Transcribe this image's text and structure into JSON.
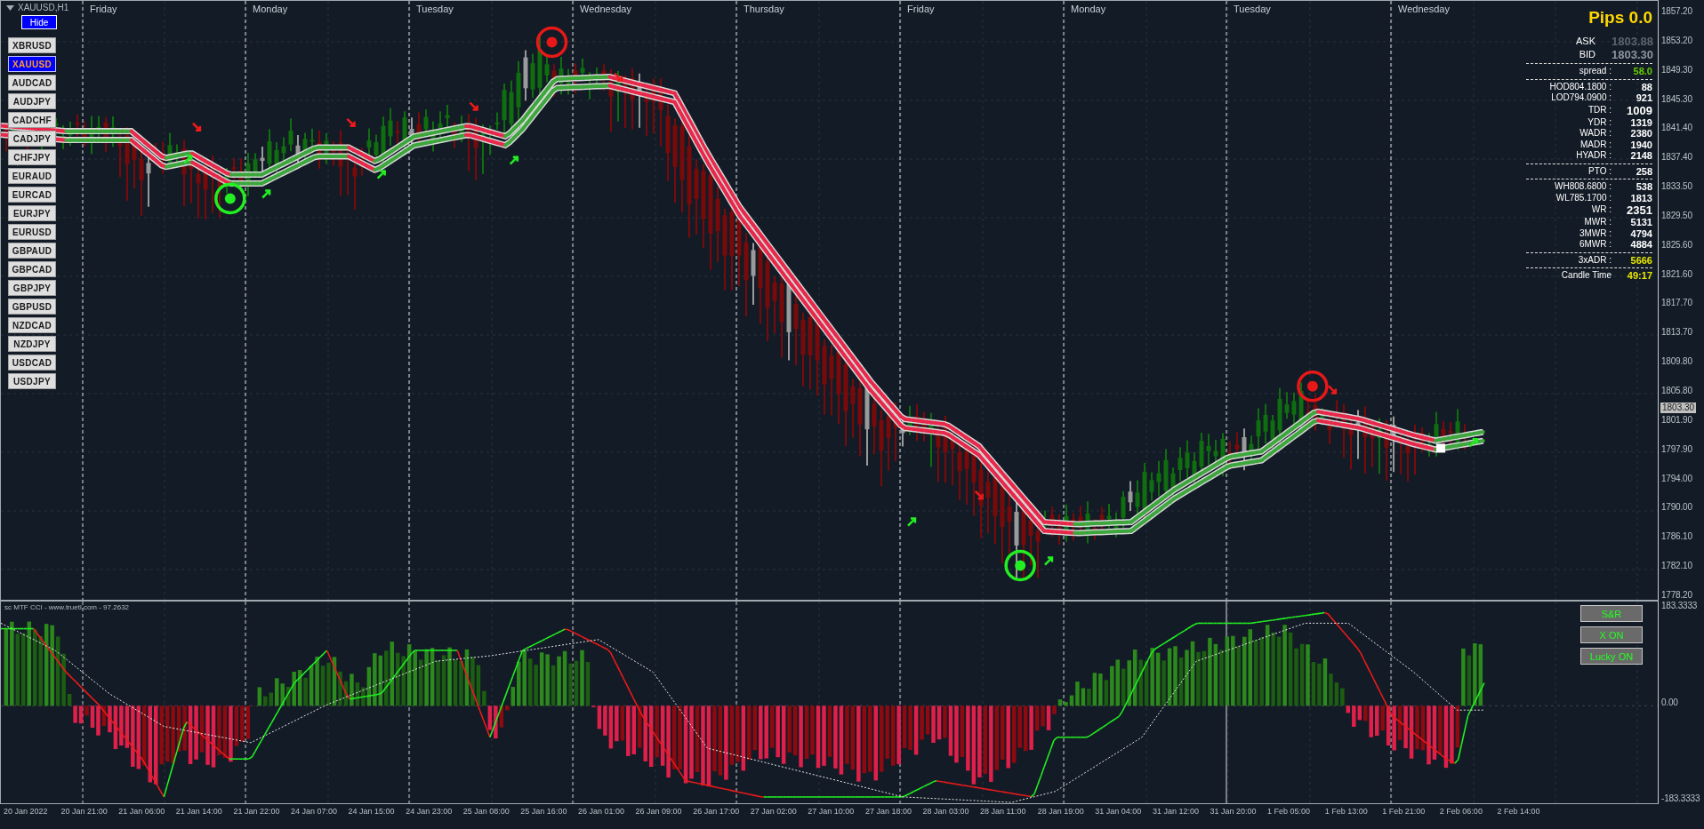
{
  "chart_title": "XAUUSD,H1",
  "hide_button": "Hide",
  "symbols": [
    {
      "label": "XBRUSD",
      "selected": false
    },
    {
      "label": "XAUUSD",
      "selected": true
    },
    {
      "label": "AUDCAD",
      "selected": false
    },
    {
      "label": "AUDJPY",
      "selected": false
    },
    {
      "label": "CADCHF",
      "selected": false
    },
    {
      "label": "CADJPY",
      "selected": false
    },
    {
      "label": "CHFJPY",
      "selected": false
    },
    {
      "label": "EURAUD",
      "selected": false
    },
    {
      "label": "EURCAD",
      "selected": false
    },
    {
      "label": "EURJPY",
      "selected": false
    },
    {
      "label": "EURUSD",
      "selected": false
    },
    {
      "label": "GBPAUD",
      "selected": false
    },
    {
      "label": "GBPCAD",
      "selected": false
    },
    {
      "label": "GBPJPY",
      "selected": false
    },
    {
      "label": "GBPUSD",
      "selected": false
    },
    {
      "label": "NZDCAD",
      "selected": false
    },
    {
      "label": "NZDJPY",
      "selected": false
    },
    {
      "label": "USDCAD",
      "selected": false
    },
    {
      "label": "USDJPY",
      "selected": false
    }
  ],
  "day_labels": [
    "Friday",
    "Monday",
    "Tuesday",
    "Wednesday",
    "Thursday",
    "Friday",
    "Monday",
    "Tuesday",
    "Wednesday"
  ],
  "info_panel": {
    "title": "Pips 0.0",
    "sections": [
      [
        {
          "label": "ASK",
          "value": "1803.88",
          "kind": "quote",
          "color": "#5c646e"
        },
        {
          "label": "BID",
          "value": "1803.30",
          "kind": "quote",
          "color": "#8c949e"
        }
      ],
      [
        {
          "label": "spread :",
          "value": "58.0",
          "kind": "normal",
          "color": "#66cc00"
        }
      ],
      [
        {
          "label": "HOD804.1800 :",
          "value": "88",
          "kind": "normal",
          "color": "#ffffff"
        },
        {
          "label": "LOD794.0900 :",
          "value": "921",
          "kind": "normal",
          "color": "#ffffff"
        },
        {
          "label": "TDR :",
          "value": "1009",
          "kind": "large",
          "color": "#ffffff"
        },
        {
          "label": "YDR :",
          "value": "1319",
          "kind": "normal",
          "color": "#ffffff"
        },
        {
          "label": "WADR :",
          "value": "2380",
          "kind": "normal",
          "color": "#ffffff"
        },
        {
          "label": "MADR :",
          "value": "1940",
          "kind": "normal",
          "color": "#ffffff"
        },
        {
          "label": "HYADR :",
          "value": "2148",
          "kind": "normal",
          "color": "#ffffff"
        }
      ],
      [
        {
          "label": "PTO :",
          "value": "258",
          "kind": "normal",
          "color": "#ffffff"
        }
      ],
      [
        {
          "label": "WH808.6800 :",
          "value": "538",
          "kind": "normal",
          "color": "#ffffff"
        },
        {
          "label": "WL785.1700 :",
          "value": "1813",
          "kind": "normal",
          "color": "#ffffff"
        },
        {
          "label": "WR :",
          "value": "2351",
          "kind": "large",
          "color": "#ffffff"
        },
        {
          "label": "MWR :",
          "value": "5131",
          "kind": "normal",
          "color": "#ffffff"
        },
        {
          "label": "3MWR :",
          "value": "4794",
          "kind": "normal",
          "color": "#ffffff"
        },
        {
          "label": "6MWR :",
          "value": "4884",
          "kind": "normal",
          "color": "#ffffff"
        }
      ],
      [
        {
          "label": "3xADR :",
          "value": "5666",
          "kind": "normal",
          "color": "#e8e800"
        }
      ],
      [
        {
          "label": "Candle Time",
          "value": "49:17",
          "kind": "normal",
          "color": "#e8e800"
        }
      ]
    ]
  },
  "price_axis": [
    "1857.20",
    "1853.20",
    "1849.30",
    "1845.30",
    "1841.40",
    "1837.40",
    "1833.50",
    "1829.50",
    "1825.60",
    "1821.60",
    "1817.70",
    "1813.70",
    "1809.80",
    "1805.80",
    "1801.90",
    "1797.90",
    "1794.00",
    "1790.00",
    "1786.10",
    "1782.10",
    "1778.20"
  ],
  "current_price": "1803.30",
  "indicator": {
    "title": "sc MTF CCI - www.truetl.com - 97.2632",
    "buttons": [
      "S&R",
      "X ON",
      "Lucky ON"
    ],
    "axis": [
      "183.3333",
      "0.00",
      "-183.3333"
    ]
  },
  "time_axis": [
    "20 Jan 2022",
    "20 Jan 21:00",
    "21 Jan 06:00",
    "21 Jan 14:00",
    "21 Jan 22:00",
    "24 Jan 07:00",
    "24 Jan 15:00",
    "24 Jan 23:00",
    "25 Jan 08:00",
    "25 Jan 16:00",
    "26 Jan 01:00",
    "26 Jan 09:00",
    "26 Jan 17:00",
    "27 Jan 02:00",
    "27 Jan 10:00",
    "27 Jan 18:00",
    "28 Jan 03:00",
    "28 Jan 11:00",
    "28 Jan 19:00",
    "31 Jan 04:00",
    "31 Jan 12:00",
    "31 Jan 20:00",
    "1 Feb 05:00",
    "1 Feb 13:00",
    "1 Feb 21:00",
    "2 Feb 06:00",
    "2 Feb 14:00"
  ]
}
